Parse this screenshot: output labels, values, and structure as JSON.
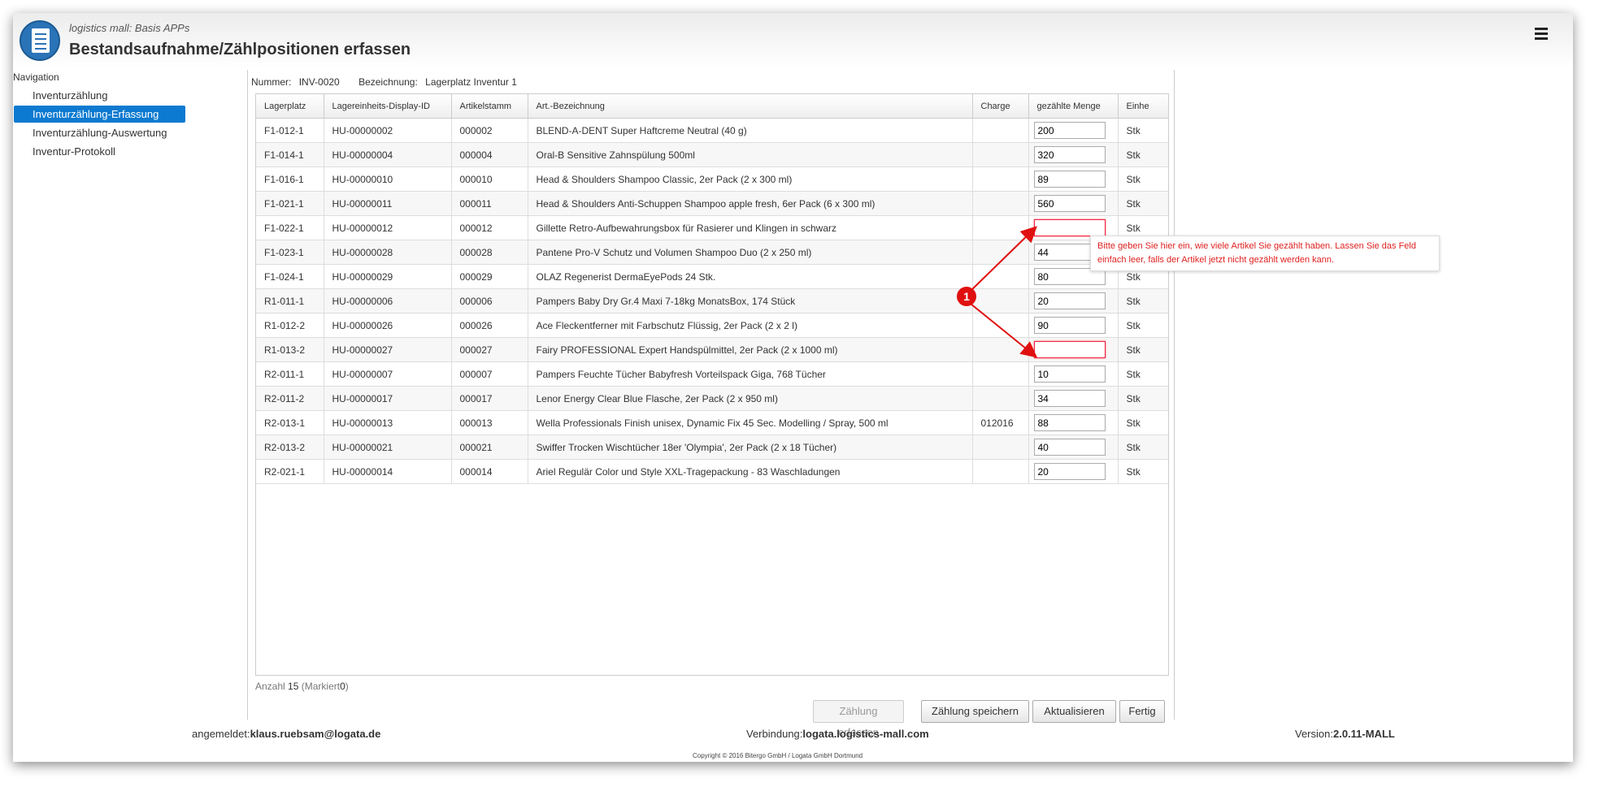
{
  "header": {
    "app_subtitle": "logistics mall: Basis APPs",
    "title": "Bestandsaufnahme/Zählpositionen erfassen",
    "menu_icon": "hamburger-icon",
    "logo_icon": "checklist-icon"
  },
  "nav": {
    "title": "Navigation",
    "items": [
      {
        "label": "Inventurzählung"
      },
      {
        "label": "Inventurzählung-Erfassung"
      },
      {
        "label": "Inventurzählung-Auswertung"
      },
      {
        "label": "Inventur-Protokoll"
      }
    ],
    "active_index": 1
  },
  "info": {
    "nummer_label": "Nummer:",
    "nummer_value": "INV-0020",
    "bezeichnung_label": "Bezeichnung:",
    "bezeichnung_value": "Lagerplatz Inventur 1"
  },
  "table": {
    "headers": [
      "Lagerplatz",
      "Lagereinheits-Display-ID",
      "Artikelstamm",
      "Art.-Bezeichnung",
      "Charge",
      "gezählte Menge",
      "Einhe"
    ],
    "rows": [
      {
        "platz": "F1-012-1",
        "he": "HU-00000002",
        "art": "000002",
        "bez": "BLEND-A-DENT Super Haftcreme Neutral (40 g)",
        "charge": "",
        "menge": "200",
        "einheit": "Stk",
        "error": false
      },
      {
        "platz": "F1-014-1",
        "he": "HU-00000004",
        "art": "000004",
        "bez": "Oral-B Sensitive Zahnspülung 500ml",
        "charge": "",
        "menge": "320",
        "einheit": "Stk",
        "error": false
      },
      {
        "platz": "F1-016-1",
        "he": "HU-00000010",
        "art": "000010",
        "bez": "Head & Shoulders Shampoo Classic, 2er Pack (2 x 300 ml)",
        "charge": "",
        "menge": "89",
        "einheit": "Stk",
        "error": false
      },
      {
        "platz": "F1-021-1",
        "he": "HU-00000011",
        "art": "000011",
        "bez": "Head & Shoulders Anti-Schuppen Shampoo apple fresh, 6er Pack (6 x 300 ml)",
        "charge": "",
        "menge": "560",
        "einheit": "Stk",
        "error": false
      },
      {
        "platz": "F1-022-1",
        "he": "HU-00000012",
        "art": "000012",
        "bez": "Gillette Retro-Aufbewahrungsbox für Rasierer und Klingen in schwarz",
        "charge": "",
        "menge": "",
        "einheit": "Stk",
        "error": true
      },
      {
        "platz": "F1-023-1",
        "he": "HU-00000028",
        "art": "000028",
        "bez": "Pantene Pro-V Schutz und Volumen Shampoo Duo (2 x 250 ml)",
        "charge": "",
        "menge": "44",
        "einheit": "Stk",
        "error": false
      },
      {
        "platz": "F1-024-1",
        "he": "HU-00000029",
        "art": "000029",
        "bez": "OLAZ Regenerist DermaEyePods 24 Stk.",
        "charge": "",
        "menge": "80",
        "einheit": "Stk",
        "error": false
      },
      {
        "platz": "R1-011-1",
        "he": "HU-00000006",
        "art": "000006",
        "bez": "Pampers Baby Dry Gr.4 Maxi 7-18kg MonatsBox, 174 Stück",
        "charge": "",
        "menge": "20",
        "einheit": "Stk",
        "error": false
      },
      {
        "platz": "R1-012-2",
        "he": "HU-00000026",
        "art": "000026",
        "bez": "Ace Fleckentferner mit Farbschutz Flüssig, 2er Pack (2 x 2 l)",
        "charge": "",
        "menge": "90",
        "einheit": "Stk",
        "error": false
      },
      {
        "platz": "R1-013-2",
        "he": "HU-00000027",
        "art": "000027",
        "bez": "Fairy PROFESSIONAL Expert Handspülmittel, 2er Pack (2 x 1000 ml)",
        "charge": "",
        "menge": "",
        "einheit": "Stk",
        "error": true
      },
      {
        "platz": "R2-011-1",
        "he": "HU-00000007",
        "art": "000007",
        "bez": "Pampers Feuchte Tücher Babyfresh Vorteilspack Giga, 768 Tücher",
        "charge": "",
        "menge": "10",
        "einheit": "Stk",
        "error": false
      },
      {
        "platz": "R2-011-2",
        "he": "HU-00000017",
        "art": "000017",
        "bez": "Lenor Energy Clear Blue Flasche, 2er Pack (2 x 950 ml)",
        "charge": "",
        "menge": "34",
        "einheit": "Stk",
        "error": false
      },
      {
        "platz": "R2-013-1",
        "he": "HU-00000013",
        "art": "000013",
        "bez": "Wella Professionals Finish unisex, Dynamic Fix 45 Sec. Modelling / Spray, 500 ml",
        "charge": "012016",
        "menge": "88",
        "einheit": "Stk",
        "error": false
      },
      {
        "platz": "R2-013-2",
        "he": "HU-00000021",
        "art": "000021",
        "bez": "Swiffer Trocken Wischtücher 18er 'Olympia', 2er Pack (2 x 18 Tücher)",
        "charge": "",
        "menge": "40",
        "einheit": "Stk",
        "error": false
      },
      {
        "platz": "R2-021-1",
        "he": "HU-00000014",
        "art": "000014",
        "bez": "Ariel Regulär Color und Style XXL-Tragepackung - 83 Waschladungen",
        "charge": "",
        "menge": "20",
        "einheit": "Stk",
        "error": false
      }
    ]
  },
  "status": {
    "anzahl_label": "Anzahl",
    "anzahl_value": "15",
    "markiert_label": "(Markiert",
    "markiert_value": "0",
    "markiert_close": ")"
  },
  "buttons": {
    "zaehlung_erfassen": "Zählung erfassen",
    "zaehlung_speichern": "Zählung speichern",
    "aktualisieren": "Aktualisieren",
    "fertig": "Fertig"
  },
  "footer": {
    "login_label": "angemeldet:",
    "login_value": "klaus.ruebsam@logata.de",
    "verbindung_label": "Verbindung:",
    "verbindung_value": "logata.logistics-mall.com",
    "version_label": "Version:",
    "version_value": "2.0.11-MALL",
    "copyright": "Copyright © 2016 Bitergo GmbH / Logata GmbH Dortmund"
  },
  "annotation": {
    "tooltip": "Bitte geben Sie hier ein, wie viele Artikel Sie gezählt haben. Lassen Sie das Feld einfach leer, falls der Artikel jetzt nicht gezählt werden kann.",
    "badge": "1",
    "accent_color": "#e01010"
  },
  "colors": {
    "nav_active": "#0c7ad0",
    "error": "#e02020"
  }
}
